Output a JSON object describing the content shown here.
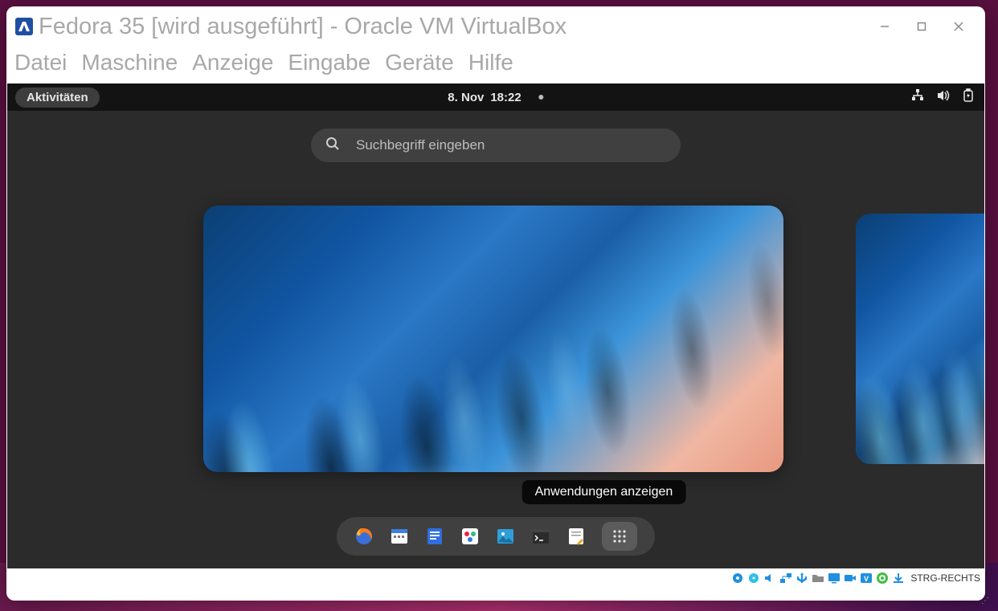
{
  "window": {
    "title": "Fedora 35 [wird ausgeführt] - Oracle VM VirtualBox"
  },
  "menu": {
    "items": [
      "Datei",
      "Maschine",
      "Anzeige",
      "Eingabe",
      "Geräte",
      "Hilfe"
    ]
  },
  "gnome": {
    "activities": "Aktivitäten",
    "date": "8. Nov",
    "time": "18:22",
    "search_placeholder": "Suchbegriff eingeben",
    "tooltip": "Anwendungen anzeigen",
    "dash": [
      {
        "name": "firefox"
      },
      {
        "name": "calendar"
      },
      {
        "name": "files"
      },
      {
        "name": "rhythmbox"
      },
      {
        "name": "photos"
      },
      {
        "name": "terminal"
      },
      {
        "name": "text-editor"
      },
      {
        "name": "app-grid"
      }
    ],
    "tray": [
      "network",
      "volume",
      "battery"
    ]
  },
  "statusbar": {
    "hostkey": "STRG-RECHTS",
    "icons": [
      "harddisk",
      "optical",
      "usb",
      "network",
      "shared",
      "clipboard",
      "display",
      "recording",
      "vrde",
      "guest-additions",
      "hostkey-state"
    ]
  }
}
